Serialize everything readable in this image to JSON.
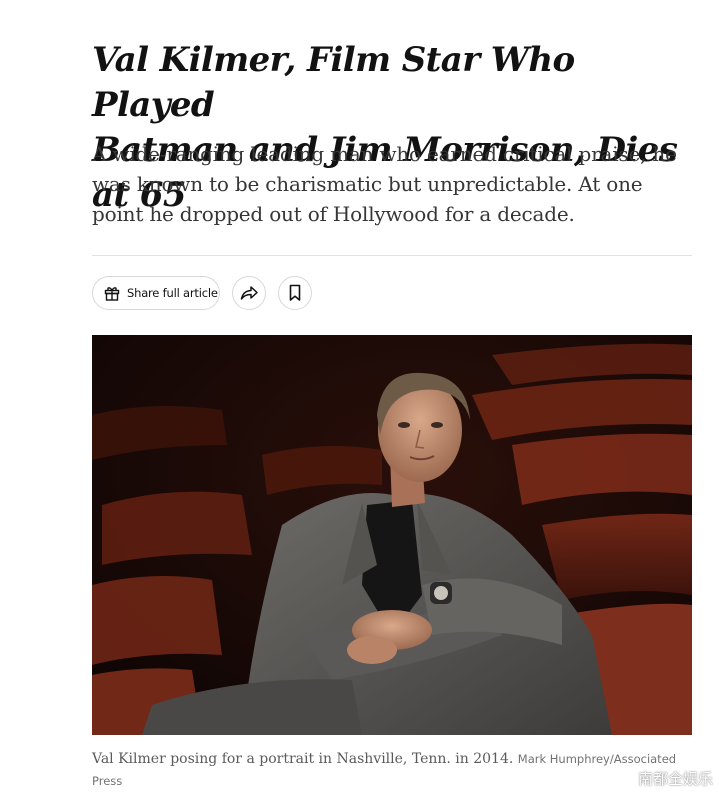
{
  "article": {
    "headline_line1": "Val Kilmer, Film Star Who Played",
    "headline_line2": "Batman and Jim Morrison, Dies at 65",
    "summary": "A wide-ranging leading man who earned critical praise, he was known to be charismatic but unpredictable. At one point he dropped out of Hollywood for a decade."
  },
  "toolbar": {
    "share_label": "Share full article",
    "share_icon": "gift-icon",
    "forward_icon": "share-arrow-icon",
    "save_icon": "bookmark-icon"
  },
  "photo": {
    "caption": "Val Kilmer posing for a portrait in Nashville, Tenn. in 2014.",
    "credit": "Mark Humphrey/Associated Press"
  },
  "watermark": {
    "text": "南都全娱乐"
  },
  "colors": {
    "text": "#121212",
    "summary": "#363636",
    "caption": "#5a5a5a",
    "border": "#d8d8d8"
  }
}
